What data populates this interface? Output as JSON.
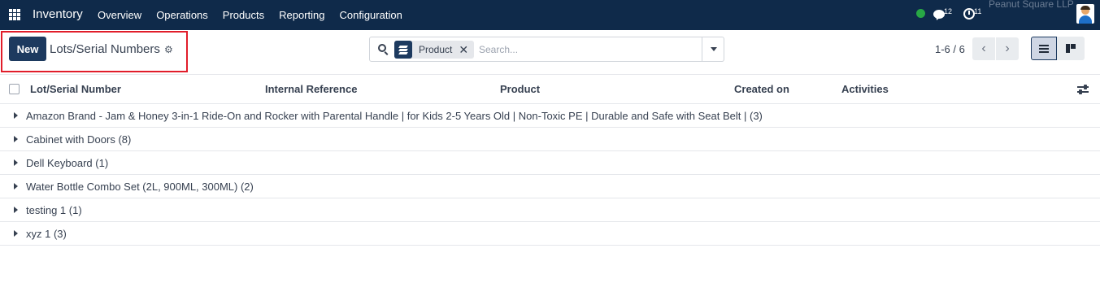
{
  "navbar": {
    "app_name": "Inventory",
    "menu": [
      "Overview",
      "Operations",
      "Products",
      "Reporting",
      "Configuration"
    ],
    "messages_count": "12",
    "activities_count": "11",
    "company": "Peanut Square LLP",
    "status_color": "#28a745",
    "bg_color": "#0f2a4a"
  },
  "control": {
    "new_label": "New",
    "title": "Lots/Serial Numbers"
  },
  "search": {
    "facet_label": "Product",
    "placeholder": "Search..."
  },
  "pager": {
    "value": "1-6 / 6"
  },
  "table": {
    "columns": [
      "Lot/Serial Number",
      "Internal Reference",
      "Product",
      "Created on",
      "Activities"
    ],
    "groups": [
      "Amazon Brand - Jam & Honey 3-in-1 Ride-On and Rocker with Parental Handle | for Kids 2-5 Years Old | Non-Toxic PE | Durable and Safe with Seat Belt | (3)",
      "Cabinet with Doors (8)",
      "Dell Keyboard (1)",
      "Water Bottle Combo Set (2L, 900ML, 300ML) (2)",
      "testing 1 (1)",
      "xyz 1 (3)"
    ]
  },
  "icons": [
    "apps-icon",
    "chat-icon",
    "clock-icon",
    "avatar",
    "gear-icon",
    "search-icon",
    "layers-icon",
    "close-icon",
    "caret-down-icon",
    "chevron-left-icon",
    "chevron-right-icon",
    "list-view-icon",
    "kanban-view-icon",
    "column-settings-icon",
    "caret-right-icon"
  ]
}
